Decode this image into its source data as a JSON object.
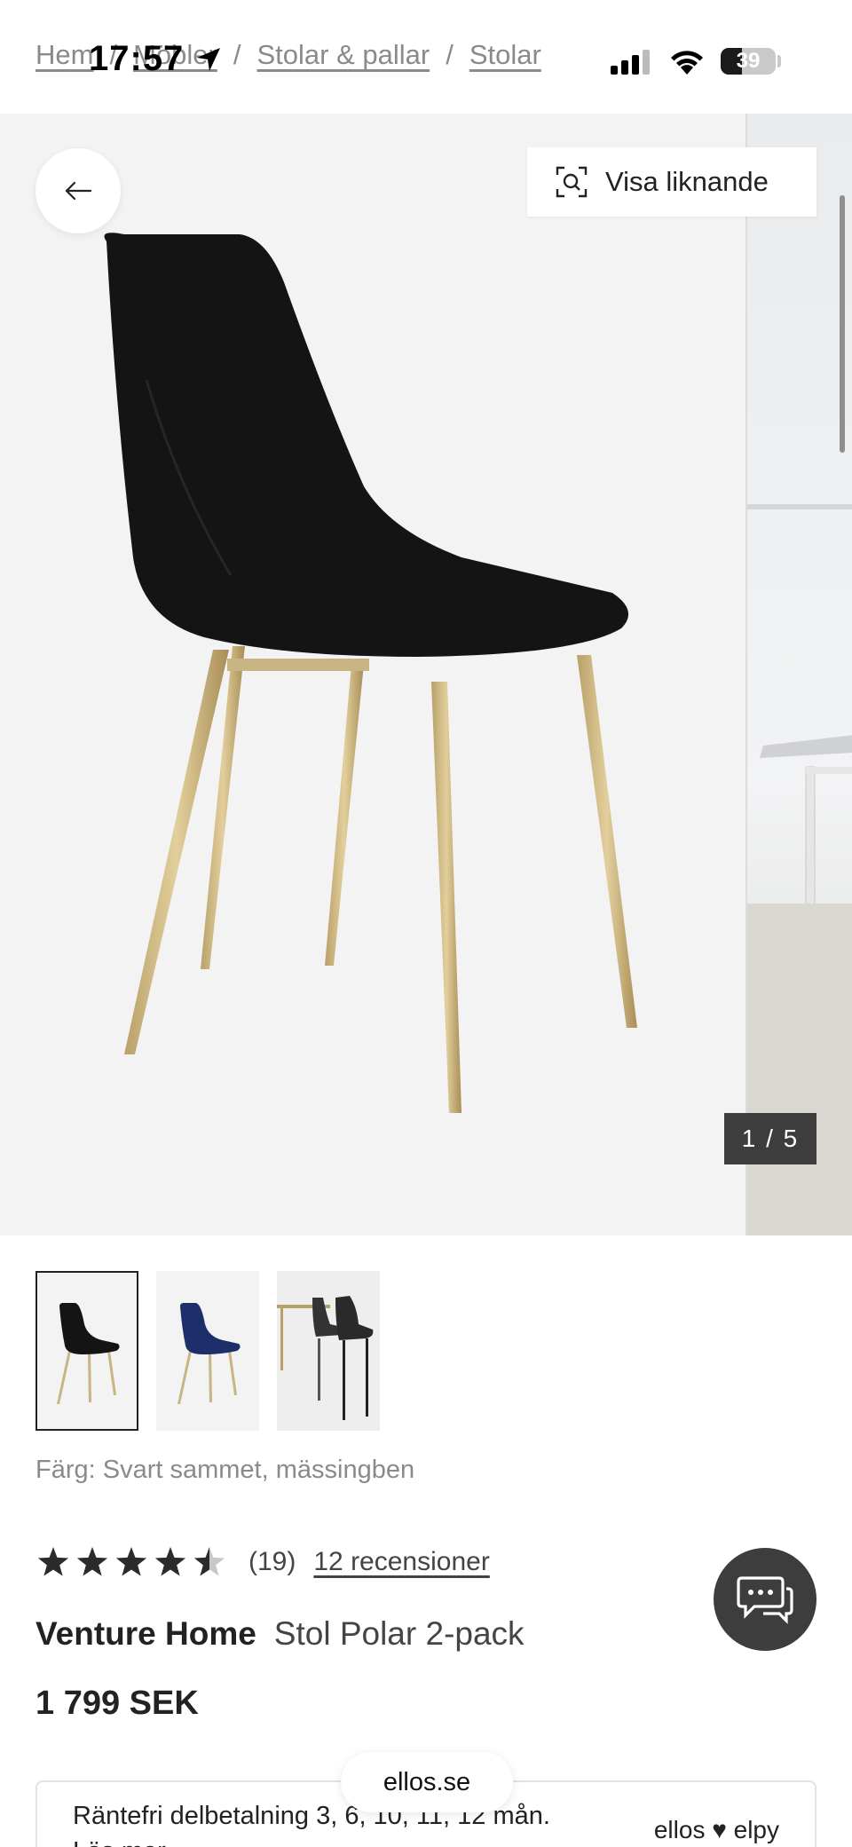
{
  "status_bar": {
    "time": "17:57",
    "battery": "39",
    "battery_level": 0.39
  },
  "breadcrumb": [
    "Hem",
    "Möbler",
    "Stolar & pallar",
    "Stolar"
  ],
  "gallery": {
    "similar_label": "Visa liknande",
    "counter": "1 / 5"
  },
  "product": {
    "color_text": "Färg: Svart sammet, mässingben",
    "rating_value": 4.5,
    "rating_count": "(19)",
    "reviews_link": "12 recensioner",
    "brand": "Venture Home",
    "name": "Stol Polar 2-pack",
    "price": "1 799 SEK"
  },
  "finance": {
    "text": "Räntefri delbetalning 3, 6, 10, 11, 12 mån.",
    "link": "Läs mer",
    "logo": "ellos ♥ elpy"
  },
  "browser": {
    "url": "ellos.se"
  },
  "icons": {
    "back": "arrow-left-icon",
    "similar": "visual-search-icon",
    "chat": "chat-icon"
  }
}
